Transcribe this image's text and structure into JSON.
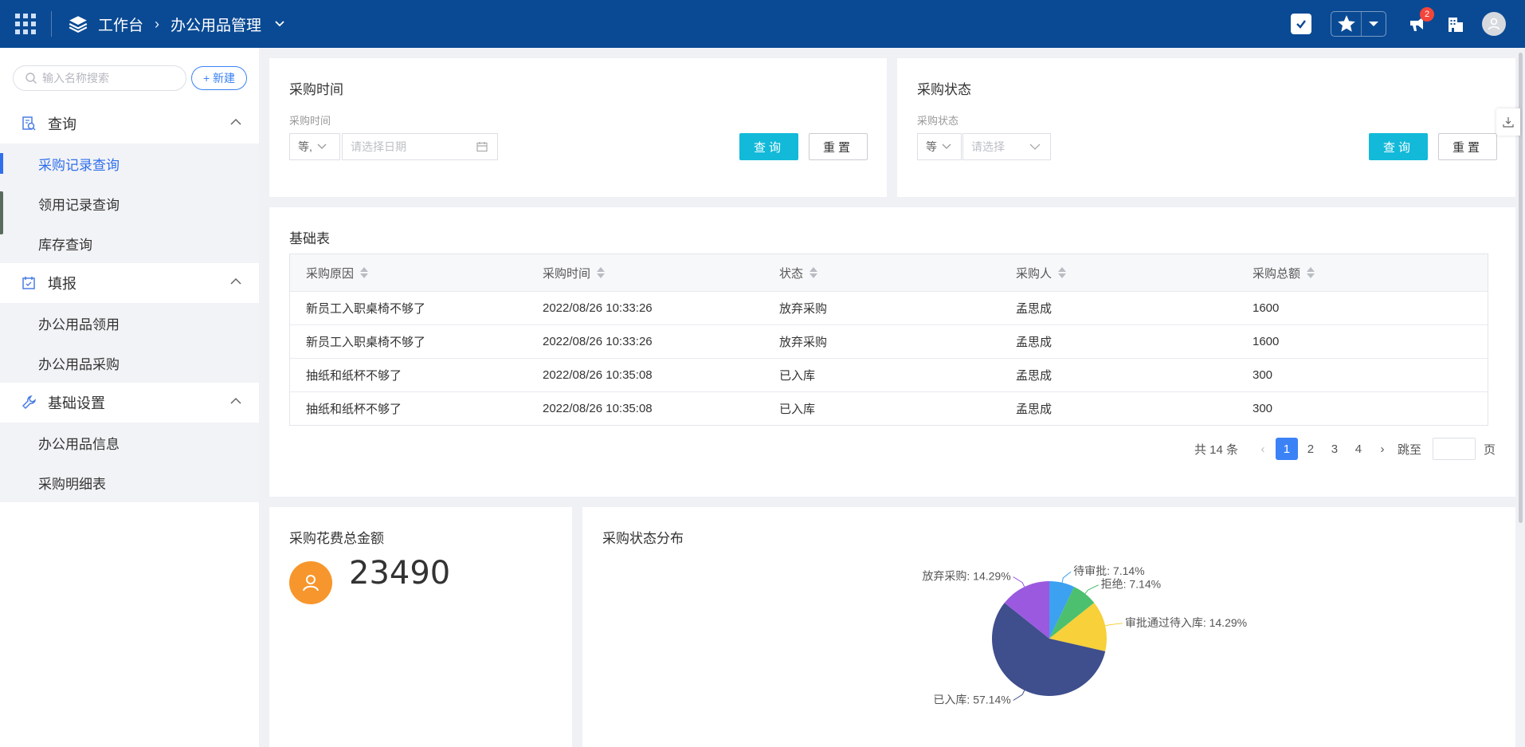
{
  "topbar": {
    "workbench": "工作台",
    "app_name": "办公用品管理",
    "badge_count": "2"
  },
  "sidebar": {
    "search_placeholder": "输入名称搜索",
    "new_label": "+ 新建",
    "groups": [
      {
        "label": "查询",
        "items": [
          "采购记录查询",
          "领用记录查询",
          "库存查询"
        ]
      },
      {
        "label": "填报",
        "items": [
          "办公用品领用",
          "办公用品采购"
        ]
      },
      {
        "label": "基础设置",
        "items": [
          "办公用品信息",
          "采购明细表"
        ]
      }
    ]
  },
  "filter_time": {
    "title": "采购时间",
    "label": "采购时间",
    "operator": "等,",
    "date_placeholder": "请选择日期",
    "query": "查询",
    "reset": "重置"
  },
  "filter_status": {
    "title": "采购状态",
    "label": "采购状态",
    "operator": "等",
    "placeholder": "请选择",
    "query": "查询",
    "reset": "重置"
  },
  "table": {
    "title": "基础表",
    "columns": [
      "采购原因",
      "采购时间",
      "状态",
      "采购人",
      "采购总额"
    ],
    "rows": [
      [
        "新员工入职桌椅不够了",
        "2022/08/26 10:33:26",
        "放弃采购",
        "孟思成",
        "1600"
      ],
      [
        "新员工入职桌椅不够了",
        "2022/08/26 10:33:26",
        "放弃采购",
        "孟思成",
        "1600"
      ],
      [
        "抽纸和纸杯不够了",
        "2022/08/26 10:35:08",
        "已入库",
        "孟思成",
        "300"
      ],
      [
        "抽纸和纸杯不够了",
        "2022/08/26 10:35:08",
        "已入库",
        "孟思成",
        "300"
      ]
    ],
    "pagination": {
      "total": "共 14 条",
      "pages": [
        "1",
        "2",
        "3",
        "4"
      ],
      "current": "1",
      "jump_label": "跳至",
      "page_label": "页"
    }
  },
  "total_card": {
    "title": "采购花费总金额",
    "value": "23490"
  },
  "chart_card": {
    "title": "采购状态分布"
  },
  "chart_data": {
    "type": "pie",
    "slices": [
      {
        "label": "待审批: 7.14%",
        "name": "待审批",
        "value": 7.14,
        "color": "#3ba1f0"
      },
      {
        "label": "拒绝: 7.14%",
        "name": "拒绝",
        "value": 7.14,
        "color": "#4cc06e"
      },
      {
        "label": "审批通过待入库: 14.29%",
        "name": "审批通过待入库",
        "value": 14.29,
        "color": "#f7d03a"
      },
      {
        "label": "已入库: 57.14%",
        "name": "已入库",
        "value": 57.14,
        "color": "#3f4e8c"
      },
      {
        "label": "放弃采购: 14.29%",
        "name": "放弃采购",
        "value": 14.29,
        "color": "#9b59e0"
      }
    ]
  }
}
